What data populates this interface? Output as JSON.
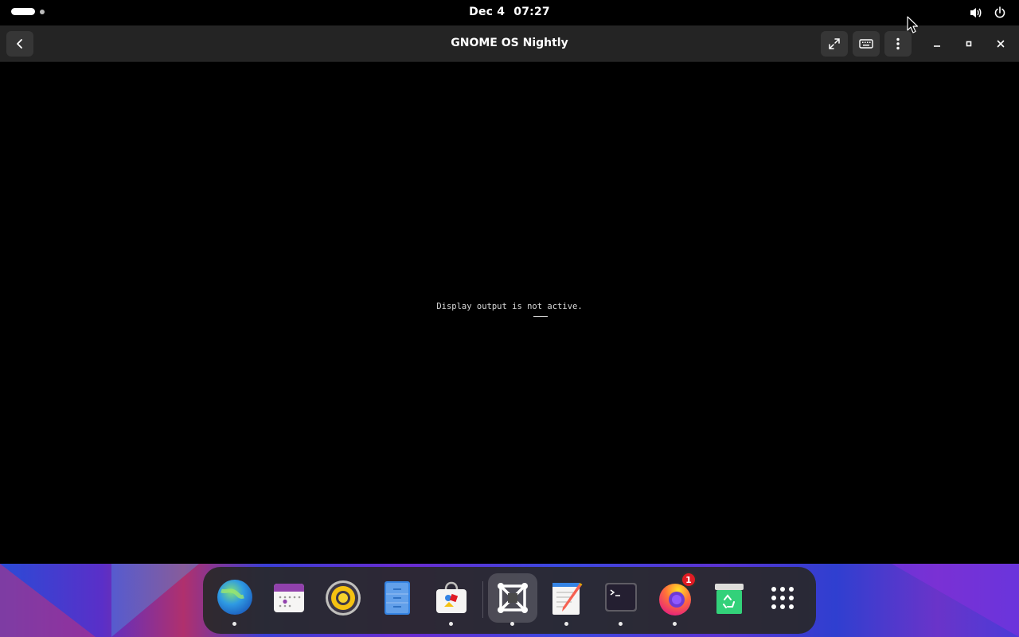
{
  "top_panel": {
    "clock_date": "Dec 4",
    "clock_time": "07:27"
  },
  "window": {
    "title": "GNOME OS Nightly",
    "message": "Display output is not active."
  },
  "icons": {
    "back": "back-arrow-icon",
    "fullscreen": "fullscreen-icon",
    "keyboard": "keyboard-icon",
    "menu": "kebab-menu-icon",
    "minimize": "minimize-icon",
    "maximize": "maximize-icon",
    "close": "close-icon",
    "volume": "volume-icon",
    "power": "power-icon"
  },
  "dock": {
    "apps": [
      {
        "name": "web-browser",
        "running": true
      },
      {
        "name": "calendar",
        "running": false
      },
      {
        "name": "rhythmbox",
        "running": false
      },
      {
        "name": "files",
        "running": false
      },
      {
        "name": "software",
        "running": true
      },
      {
        "name": "boxes",
        "running": true,
        "focused": true
      },
      {
        "name": "text-editor",
        "running": true
      },
      {
        "name": "terminal",
        "running": true
      },
      {
        "name": "firefox",
        "running": true,
        "badge": "1"
      },
      {
        "name": "trash",
        "running": false
      },
      {
        "name": "show-apps",
        "running": false
      }
    ]
  },
  "colors": {
    "headerbar": "#242424",
    "badge": "#e01b24"
  }
}
